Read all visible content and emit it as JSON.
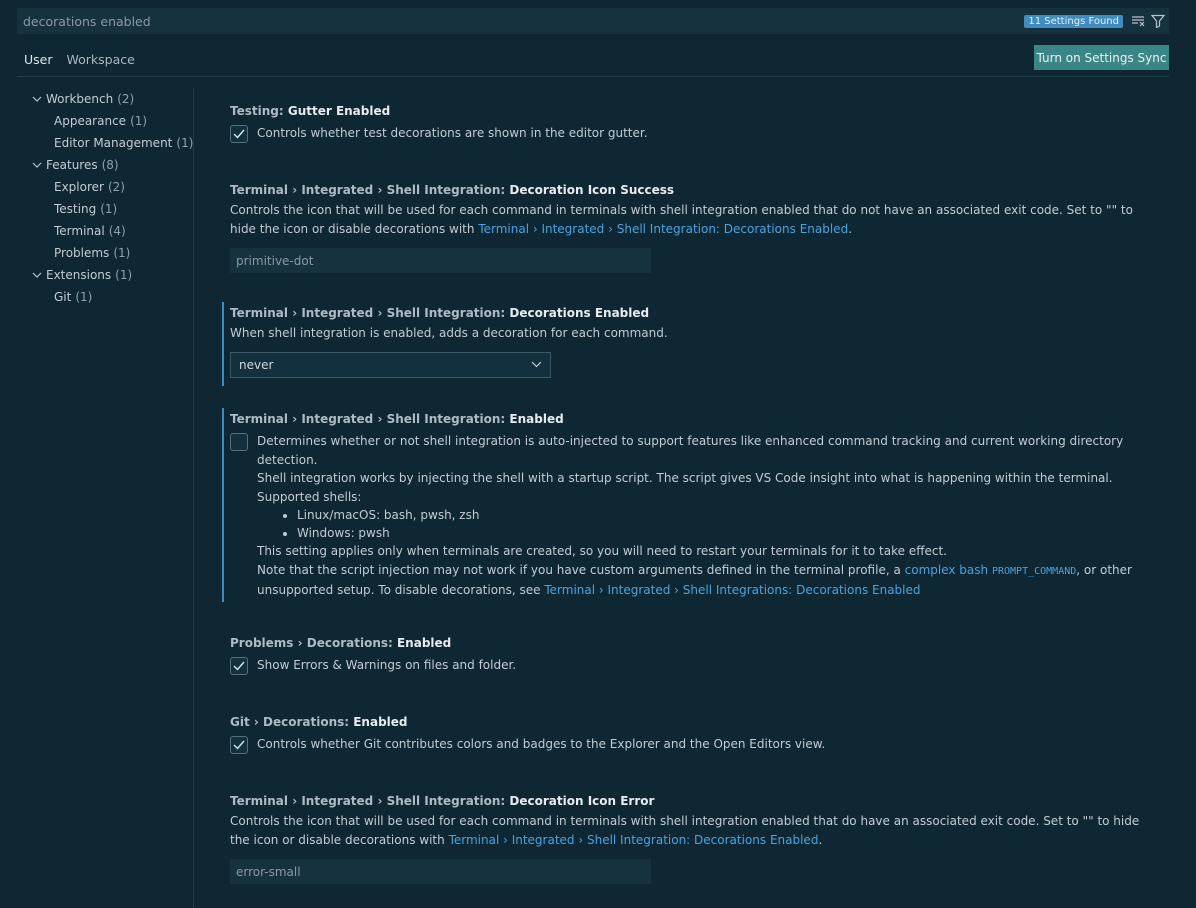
{
  "search": {
    "query": "decorations enabled",
    "count_badge": "11 Settings Found",
    "clear_icon": "clear-filter-icon",
    "filter_icon": "filter-icon"
  },
  "tabs": [
    {
      "label": "User",
      "active": true
    },
    {
      "label": "Workspace",
      "active": false
    }
  ],
  "sync_button": "Turn on Settings Sync",
  "toc": [
    {
      "label": "Workbench",
      "count": "(2)",
      "level": 0,
      "expanded": true
    },
    {
      "label": "Appearance",
      "count": "(1)",
      "level": 1
    },
    {
      "label": "Editor Management",
      "count": "(1)",
      "level": 1
    },
    {
      "label": "Features",
      "count": "(8)",
      "level": 0,
      "expanded": true
    },
    {
      "label": "Explorer",
      "count": "(2)",
      "level": 1
    },
    {
      "label": "Testing",
      "count": "(1)",
      "level": 1
    },
    {
      "label": "Terminal",
      "count": "(4)",
      "level": 1
    },
    {
      "label": "Problems",
      "count": "(1)",
      "level": 1
    },
    {
      "label": "Extensions",
      "count": "(1)",
      "level": 0,
      "expanded": true
    },
    {
      "label": "Git",
      "count": "(1)",
      "level": 1
    }
  ],
  "settings": {
    "s1": {
      "category": "Testing: ",
      "name": "Gutter Enabled",
      "desc": "Controls whether test decorations are shown in the editor gutter.",
      "checked": true
    },
    "s2": {
      "category": "Terminal › Integrated › Shell Integration: ",
      "name": "Decoration Icon Success",
      "desc1": "Controls the icon that will be used for each command in terminals with shell integration enabled that do not have an associated exit code. Set to ",
      "quote": "\"\"",
      "desc2": " to hide the icon or disable decorations with ",
      "link": "Terminal › Integrated › Shell Integration: Decorations Enabled",
      "desc3": ".",
      "value": "primitive-dot"
    },
    "s3": {
      "category": "Terminal › Integrated › Shell Integration: ",
      "name": "Decorations Enabled",
      "desc": "When shell integration is enabled, adds a decoration for each command.",
      "value": "never"
    },
    "s4": {
      "category": "Terminal › Integrated › Shell Integration: ",
      "name": "Enabled",
      "checked": false,
      "p1": "Determines whether or not shell integration is auto-injected to support features like enhanced command tracking and current working directory detection.",
      "p2": "Shell integration works by injecting the shell with a startup script. The script gives VS Code insight into what is happening within the terminal.",
      "p3": "Supported shells:",
      "shells": [
        "Linux/macOS: bash, pwsh, zsh",
        "Windows: pwsh"
      ],
      "p4": "This setting applies only when terminals are created, so you will need to restart your terminals for it to take effect.",
      "p5a": "Note that the script injection may not work if you have custom arguments defined in the terminal profile, a ",
      "p5link": "complex bash",
      "p5code": "PROMPT_COMMAND",
      "p5b": ", or other unsupported setup. To disable decorations, see ",
      "p5link2": "Terminal › Integrated › Shell Integrations: Decorations Enabled"
    },
    "s5": {
      "category": "Problems › Decorations: ",
      "name": "Enabled",
      "desc": "Show Errors & Warnings on files and folder.",
      "checked": true
    },
    "s6": {
      "category": "Git › Decorations: ",
      "name": "Enabled",
      "desc": "Controls whether Git contributes colors and badges to the Explorer and the Open Editors view.",
      "checked": true
    },
    "s7": {
      "category": "Terminal › Integrated › Shell Integration: ",
      "name": "Decoration Icon Error",
      "desc1": "Controls the icon that will be used for each command in terminals with shell integration enabled that do have an associated exit code. Set to ",
      "quote": "\"\"",
      "desc2": " to hide the icon or disable decorations with ",
      "link": "Terminal › Integrated › Shell Integration: Decorations Enabled",
      "desc3": ".",
      "value": "error-small"
    }
  },
  "colors": {
    "background": "#0f2733",
    "accent": "#3e8cc0",
    "link": "#4aa3df",
    "sync_button": "#3a8585"
  }
}
